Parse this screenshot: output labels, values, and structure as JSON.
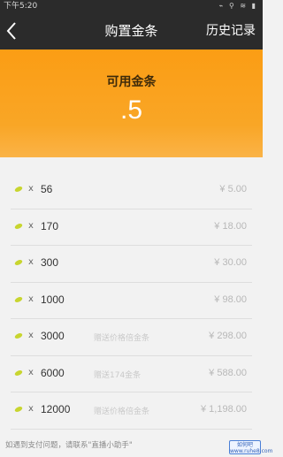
{
  "status_bar": {
    "time": "下午5:20",
    "icons": "⌁ ⚲ ≋ ▮"
  },
  "nav": {
    "back_icon": "chevron-left-icon",
    "title": "购置金条",
    "history_label": "历史记录"
  },
  "balance": {
    "label": "可用金条",
    "value": ".5",
    "color": "#fb9d14"
  },
  "packages": [
    {
      "times": "x",
      "qty": "56",
      "bonus": "",
      "price": "¥ 5.00"
    },
    {
      "times": "x",
      "qty": "170",
      "bonus": "",
      "price": "¥ 18.00"
    },
    {
      "times": "x",
      "qty": "300",
      "bonus": "",
      "price": "¥ 30.00"
    },
    {
      "times": "x",
      "qty": "1000",
      "bonus": "",
      "price": "¥ 98.00"
    },
    {
      "times": "x",
      "qty": "3000",
      "bonus": "赠送价格倍金条",
      "price": "¥ 298.00"
    },
    {
      "times": "x",
      "qty": "6000",
      "bonus": "赠送174金条",
      "price": "¥ 588.00"
    },
    {
      "times": "x",
      "qty": "12000",
      "bonus": "赠送价格倍金条",
      "price": "¥ 1,198.00"
    }
  ],
  "footer": {
    "note": "如遇到支付问题，请联系\"直播小助手\""
  },
  "watermark": {
    "line1": "如何吧",
    "line2": "www.ruhe8.com"
  }
}
